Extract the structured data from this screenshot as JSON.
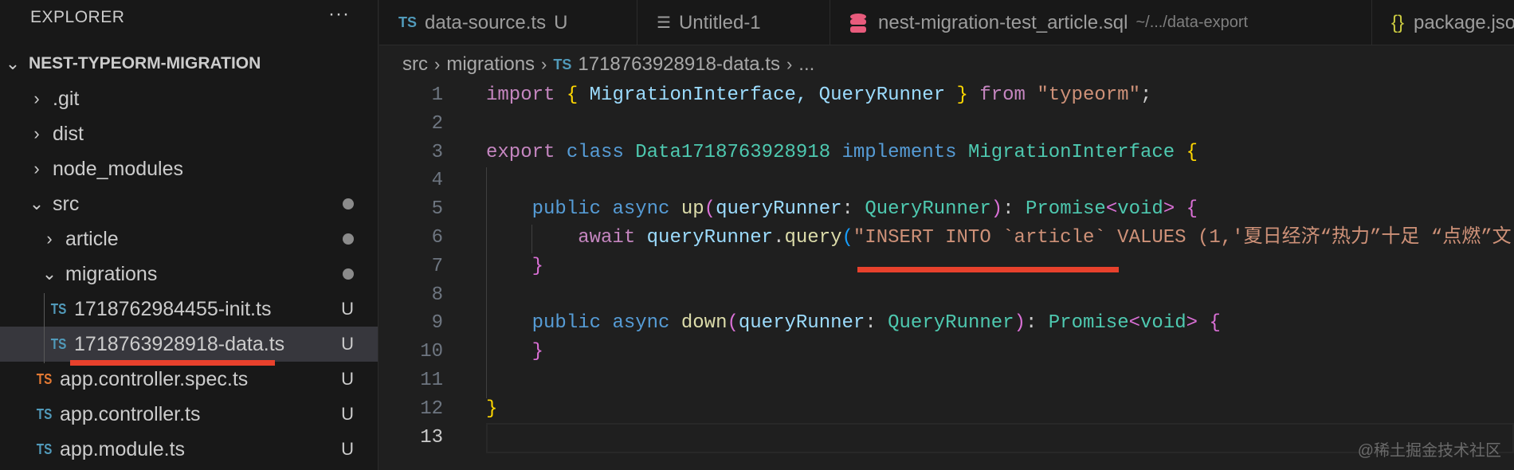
{
  "sidebar": {
    "title": "EXPLORER",
    "more": "···",
    "root": "NEST-TYPEORM-MIGRATION",
    "items": [
      {
        "label": ".git",
        "type": "folder",
        "open": false,
        "depth": 1
      },
      {
        "label": "dist",
        "type": "folder",
        "open": false,
        "depth": 1
      },
      {
        "label": "node_modules",
        "type": "folder",
        "open": false,
        "depth": 1
      },
      {
        "label": "src",
        "type": "folder",
        "open": true,
        "depth": 1,
        "dot": true
      },
      {
        "label": "article",
        "type": "folder",
        "open": false,
        "depth": 2,
        "dot": true
      },
      {
        "label": "migrations",
        "type": "folder",
        "open": true,
        "depth": 2,
        "dot": true
      },
      {
        "label": "1718762984455-init.ts",
        "type": "ts",
        "depth": 3,
        "badge": "U"
      },
      {
        "label": "1718763928918-data.ts",
        "type": "ts",
        "depth": 3,
        "badge": "U",
        "selected": true
      },
      {
        "label": "app.controller.spec.ts",
        "type": "ts-test",
        "depth": 2,
        "badge": "U"
      },
      {
        "label": "app.controller.ts",
        "type": "ts",
        "depth": 2,
        "badge": "U"
      },
      {
        "label": "app.module.ts",
        "type": "ts",
        "depth": 2,
        "badge": "U"
      }
    ]
  },
  "tabs": [
    {
      "label": "data-source.ts",
      "icon": "ts-icon",
      "icon_text": "TS",
      "modified": "U"
    },
    {
      "label": "Untitled-1",
      "icon": "text-lines-icon",
      "icon_text": "☰"
    },
    {
      "label": "nest-migration-test_article.sql",
      "icon": "database-icon",
      "description": "~/.../data-export"
    },
    {
      "label": "package.json",
      "icon": "json-braces-icon",
      "icon_text": "{}"
    }
  ],
  "breadcrumb": [
    "src",
    "migrations",
    "1718763928918-data.ts",
    "..."
  ],
  "breadcrumb_ts": "TS",
  "editor": {
    "current_line": 13,
    "lines": [
      [
        [
          "import",
          "k"
        ],
        [
          " ",
          "w"
        ],
        [
          "{",
          "y"
        ],
        [
          " MigrationInterface, QueryRunner ",
          "v"
        ],
        [
          "}",
          "y"
        ],
        [
          " ",
          "w"
        ],
        [
          "from",
          "k"
        ],
        [
          " ",
          "w"
        ],
        [
          "\"typeorm\"",
          "s"
        ],
        [
          ";",
          "w"
        ]
      ],
      [],
      [
        [
          "export",
          "k"
        ],
        [
          " ",
          "w"
        ],
        [
          "class",
          "b"
        ],
        [
          " ",
          "w"
        ],
        [
          "Data1718763928918",
          "t"
        ],
        [
          " ",
          "w"
        ],
        [
          "implements",
          "b"
        ],
        [
          " ",
          "w"
        ],
        [
          "MigrationInterface",
          "t"
        ],
        [
          " ",
          "w"
        ],
        [
          "{",
          "y"
        ]
      ],
      [],
      [
        [
          "    ",
          "w"
        ],
        [
          "public",
          "b"
        ],
        [
          " ",
          "w"
        ],
        [
          "async",
          "b"
        ],
        [
          " ",
          "w"
        ],
        [
          "up",
          "f"
        ],
        [
          "(",
          "p"
        ],
        [
          "queryRunner",
          "v"
        ],
        [
          ": ",
          "w"
        ],
        [
          "QueryRunner",
          "t"
        ],
        [
          ")",
          "p"
        ],
        [
          ": ",
          "w"
        ],
        [
          "Promise",
          "t"
        ],
        [
          "<",
          "p"
        ],
        [
          "void",
          "t"
        ],
        [
          ">",
          "p"
        ],
        [
          " ",
          "w"
        ],
        [
          "{",
          "p"
        ]
      ],
      [
        [
          "        ",
          "w"
        ],
        [
          "await",
          "k"
        ],
        [
          " ",
          "w"
        ],
        [
          "queryRunner",
          "v"
        ],
        [
          ".",
          "w"
        ],
        [
          "query",
          "f"
        ],
        [
          "(",
          "q"
        ],
        [
          "\"INSERT INTO `article` VALUES (1,'夏日经济“热力”十足 “点燃”文",
          "s"
        ]
      ],
      [
        [
          "    ",
          "w"
        ],
        [
          "}",
          "p"
        ]
      ],
      [],
      [
        [
          "    ",
          "w"
        ],
        [
          "public",
          "b"
        ],
        [
          " ",
          "w"
        ],
        [
          "async",
          "b"
        ],
        [
          " ",
          "w"
        ],
        [
          "down",
          "f"
        ],
        [
          "(",
          "p"
        ],
        [
          "queryRunner",
          "v"
        ],
        [
          ": ",
          "w"
        ],
        [
          "QueryRunner",
          "t"
        ],
        [
          ")",
          "p"
        ],
        [
          ": ",
          "w"
        ],
        [
          "Promise",
          "t"
        ],
        [
          "<",
          "p"
        ],
        [
          "void",
          "t"
        ],
        [
          ">",
          "p"
        ],
        [
          " ",
          "w"
        ],
        [
          "{",
          "p"
        ]
      ],
      [
        [
          "    ",
          "w"
        ],
        [
          "}",
          "p"
        ]
      ],
      [],
      [
        [
          "}",
          "y"
        ]
      ],
      []
    ]
  },
  "watermark": "@稀土掘金技术社区",
  "colors": {
    "accent_underline": "#e8412c",
    "selected_row": "#37373d"
  }
}
